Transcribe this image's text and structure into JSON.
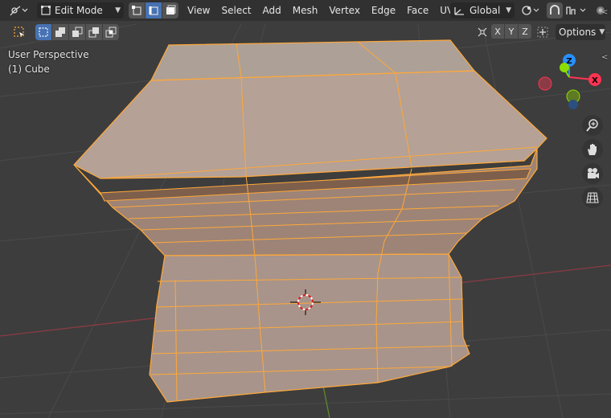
{
  "header": {
    "mode_label": "Edit Mode",
    "menus": [
      "View",
      "Select",
      "Add",
      "Mesh",
      "Vertex",
      "Edge",
      "Face",
      "UV"
    ],
    "orientation_label": "Global",
    "icons": {
      "editor_type": "axis-editor-icon",
      "mode": "edit-mode-icon",
      "select_vertex": "vertex-select-icon",
      "select_edge": "edge-select-icon",
      "select_face": "face-select-icon",
      "transform_orientation": "orientation-icon",
      "pivot": "pivot-icon",
      "snap": "snap-icon",
      "proportional": "proportional-edit-icon",
      "falloff": "falloff-icon",
      "overlays": "overlay-dot-icon"
    }
  },
  "tool_header": {
    "options_label": "Options",
    "axes": [
      "X",
      "Y",
      "Z"
    ]
  },
  "viewport": {
    "perspective_label": "User Perspective",
    "object_label": "(1) Cube",
    "gizmo": {
      "z_label": "Z",
      "x_label": "X",
      "colors": {
        "x": "#ff3352",
        "y": "#8bdc00",
        "z": "#2890ff"
      }
    },
    "nav_icons": [
      "zoom-icon",
      "pan-hand-icon",
      "camera-icon",
      "grid-ortho-icon"
    ]
  },
  "colors": {
    "accent": "#4772b3",
    "selection_edge": "#ffa83a",
    "mesh_face": "#b39a8c",
    "background": "#3d3d3d"
  }
}
